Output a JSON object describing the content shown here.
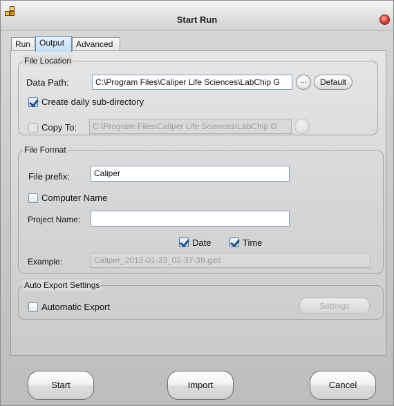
{
  "window": {
    "title": "Start Run"
  },
  "tabs": [
    {
      "label": "Run"
    },
    {
      "label": "Output"
    },
    {
      "label": "Advanced"
    }
  ],
  "file_location": {
    "group_title": "File Location",
    "data_path_label": "Data Path:",
    "data_path_value": "C:\\Program Files\\Caliper Life Sciences\\LabChip G",
    "browse_label": "...",
    "default_button": "Default",
    "create_daily_label": "Create daily sub-directory",
    "create_daily_checked": true,
    "copy_to_label": "Copy To:",
    "copy_to_checked": false,
    "copy_to_value": "C:\\Program Files\\Caliper Life Sciences\\LabChip G"
  },
  "file_format": {
    "group_title": "File Format",
    "prefix_label": "File prefix:",
    "prefix_value": "Caliper",
    "computer_name_label": "Computer Name",
    "computer_name_checked": false,
    "project_name_label": "Project Name:",
    "project_name_value": "",
    "date_label": "Date",
    "date_checked": true,
    "time_label": "Time",
    "time_checked": true,
    "example_label": "Example:",
    "example_value": "Caliper_2012-01-23_02-37-39.gxd"
  },
  "auto_export": {
    "group_title": "Auto Export Settings",
    "automatic_export_label": "Automatic Export",
    "automatic_export_checked": false,
    "settings_button": "Settings"
  },
  "footer": {
    "start_button": "Start",
    "import_button": "Import",
    "cancel_button": "Cancel"
  }
}
